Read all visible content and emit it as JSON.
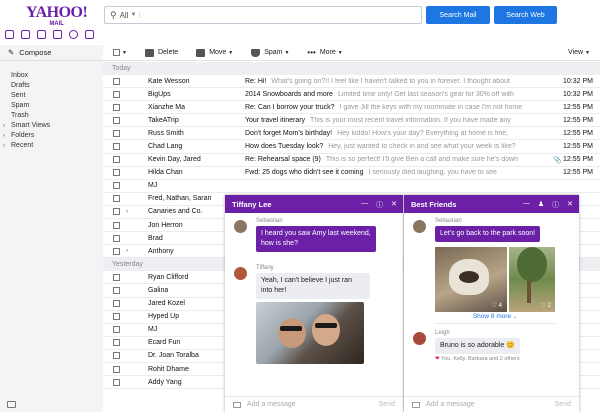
{
  "header": {
    "logo": "YAHOO!",
    "logo_sub": "MAIL",
    "search_scope": "All",
    "search_placeholder": "",
    "search_mail_label": "Search Mail",
    "search_web_label": "Search Web"
  },
  "sidebar": {
    "compose_label": "Compose",
    "folders": [
      {
        "label": "Inbox",
        "expandable": false
      },
      {
        "label": "Drafts",
        "expandable": false
      },
      {
        "label": "Sent",
        "expandable": false
      },
      {
        "label": "Spam",
        "expandable": false
      },
      {
        "label": "Trash",
        "expandable": false
      },
      {
        "label": "Smart Views",
        "expandable": true
      },
      {
        "label": "Folders",
        "expandable": true
      },
      {
        "label": "Recent",
        "expandable": true
      }
    ]
  },
  "toolbar": {
    "delete_label": "Delete",
    "move_label": "Move",
    "spam_label": "Spam",
    "more_label": "More",
    "view_label": "View"
  },
  "list": {
    "today_label": "Today",
    "yesterday_label": "Yesterday",
    "today_rows": [
      {
        "from": "Kate Wesson",
        "subject": "Re: Hi!",
        "snippet": "What's going on?!! I feel like I haven't talked to you in forever. I thought about",
        "time": "10:32 PM",
        "thread": false,
        "attach": false
      },
      {
        "from": "BigUps",
        "subject": "2014 Snowboards and more",
        "snippet": "Limited time only! Get last season's gear for 30% off with",
        "time": "10:32 PM",
        "thread": false,
        "attach": false
      },
      {
        "from": "Xianzhe Ma",
        "subject": "Re: Can I borrow your truck?",
        "snippet": "I gave Jill the keys with my roommate in case I'm not home",
        "time": "12:55 PM",
        "thread": false,
        "attach": false
      },
      {
        "from": "TakeATrip",
        "subject": "Your travel itinerary",
        "snippet": "This is your most recent travel information. If you have made any",
        "time": "12:55 PM",
        "thread": false,
        "attach": false
      },
      {
        "from": "Russ Smith",
        "subject": "Don't forget Mom's birthday!",
        "snippet": "Hey kiddo! How's your day? Everything at home is fine,",
        "time": "12:55 PM",
        "thread": false,
        "attach": false
      },
      {
        "from": "Chad Lang",
        "subject": "How does Tuesday look?",
        "snippet": "Hey, just wanted to check in and see what your week is like?",
        "time": "12:55 PM",
        "thread": false,
        "attach": false
      },
      {
        "from": "Kevin Day, Jared",
        "subject": "Re: Rehearsal space (9)",
        "snippet": "This is so perfect! I'll give Ben a call and make sure he's down",
        "time": "12:55 PM",
        "thread": false,
        "attach": true
      },
      {
        "from": "Hilda Chan",
        "subject": "Fwd: 25 dogs who didn't see it coming",
        "snippet": "I seriously died laughing, you have to see",
        "time": "12:55 PM",
        "thread": false,
        "attach": false
      },
      {
        "from": "MJ",
        "subject": "",
        "snippet": "",
        "time": "",
        "thread": false,
        "attach": false
      },
      {
        "from": "Fred, Nathan, Saran",
        "subject": "",
        "snippet": "",
        "time": "",
        "thread": false,
        "attach": false
      },
      {
        "from": "Canaries and Co.",
        "subject": "",
        "snippet": "",
        "time": "",
        "thread": true,
        "attach": false
      },
      {
        "from": "Jon Herron",
        "subject": "",
        "snippet": "",
        "time": "",
        "thread": false,
        "attach": false
      },
      {
        "from": "Brad",
        "subject": "",
        "snippet": "",
        "time": "",
        "thread": false,
        "attach": false
      },
      {
        "from": "Anthony",
        "subject": "",
        "snippet": "",
        "time": "",
        "thread": true,
        "attach": false
      }
    ],
    "yesterday_rows": [
      {
        "from": "Ryan Clifford",
        "thread": false
      },
      {
        "from": "Galina",
        "thread": false
      },
      {
        "from": "Jared Kozel",
        "thread": false
      },
      {
        "from": "Hyped Up",
        "thread": false
      },
      {
        "from": "MJ",
        "thread": false
      },
      {
        "from": "Ecard Fun",
        "thread": false
      },
      {
        "from": "Dr. Joan Toralba",
        "thread": false
      },
      {
        "from": "Rohit Dhame",
        "thread": false
      },
      {
        "from": "Addy Yang",
        "thread": false
      }
    ]
  },
  "chat1": {
    "title": "Tiffany Lee",
    "msg1_sender": "Sebastian",
    "msg1_text": "I heard you saw Amy last weekend, how is she?",
    "msg2_sender": "Tiffany",
    "msg2_text": "Yeah, I can't believe I just ran into her!",
    "input_placeholder": "Add a message",
    "send_label": "Send"
  },
  "chat2": {
    "title": "Best Friends",
    "msg1_sender": "Sebastian",
    "msg1_text": "Let's go back to the park soon!",
    "photo_count_1": "4",
    "photo_count_2": "2",
    "show_more": "Show 8 more",
    "msg2_sender": "Leigh",
    "msg2_text": "Bruno is so adorable 😊",
    "likes_text": "You, Kelly, Barbara and 2 others",
    "input_placeholder": "Add a message",
    "send_label": "Send"
  },
  "colors": {
    "brand": "#6b20a7",
    "button_blue": "#1e76e3"
  }
}
